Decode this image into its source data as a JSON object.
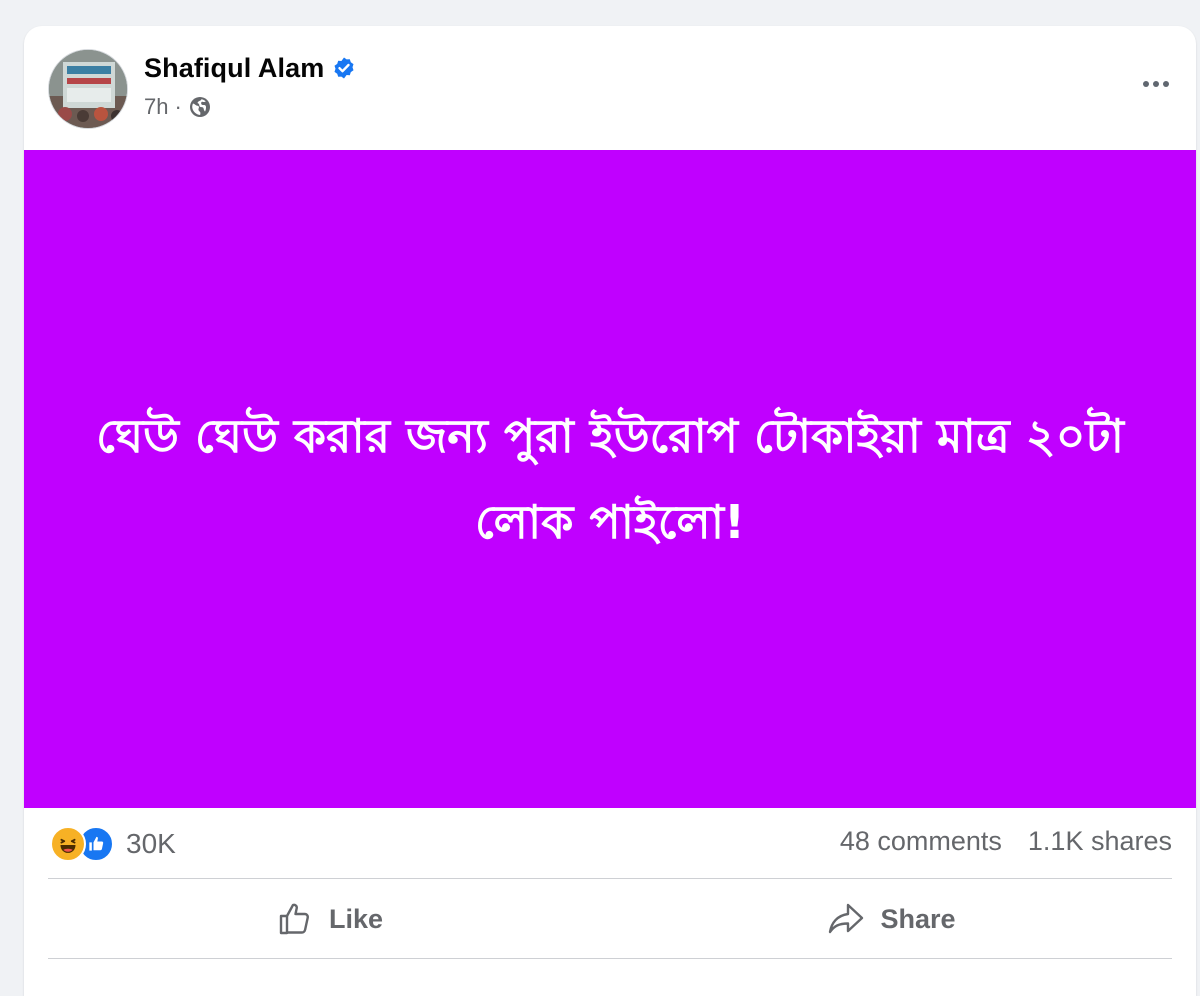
{
  "post": {
    "author": "Shafiqul Alam",
    "time": "7h",
    "separator": "·",
    "privacy_icon": "globe-icon",
    "verified_icon": "verified-badge-icon",
    "text": "ঘেউ ঘেউ করার জন্য পুরা ইউরোপ টোকাইয়া মাত্র ২০টা লোক পাইলো!",
    "background_color": "#c000ff"
  },
  "stats": {
    "reaction_icons": [
      "haha-icon",
      "like-icon"
    ],
    "reaction_count": "30K",
    "comments": "48 comments",
    "shares": "1.1K shares"
  },
  "actions": {
    "like_label": "Like",
    "share_label": "Share"
  },
  "colors": {
    "accent": "#1877f2",
    "secondary_text": "#65676b",
    "haha": "#f7b125"
  }
}
